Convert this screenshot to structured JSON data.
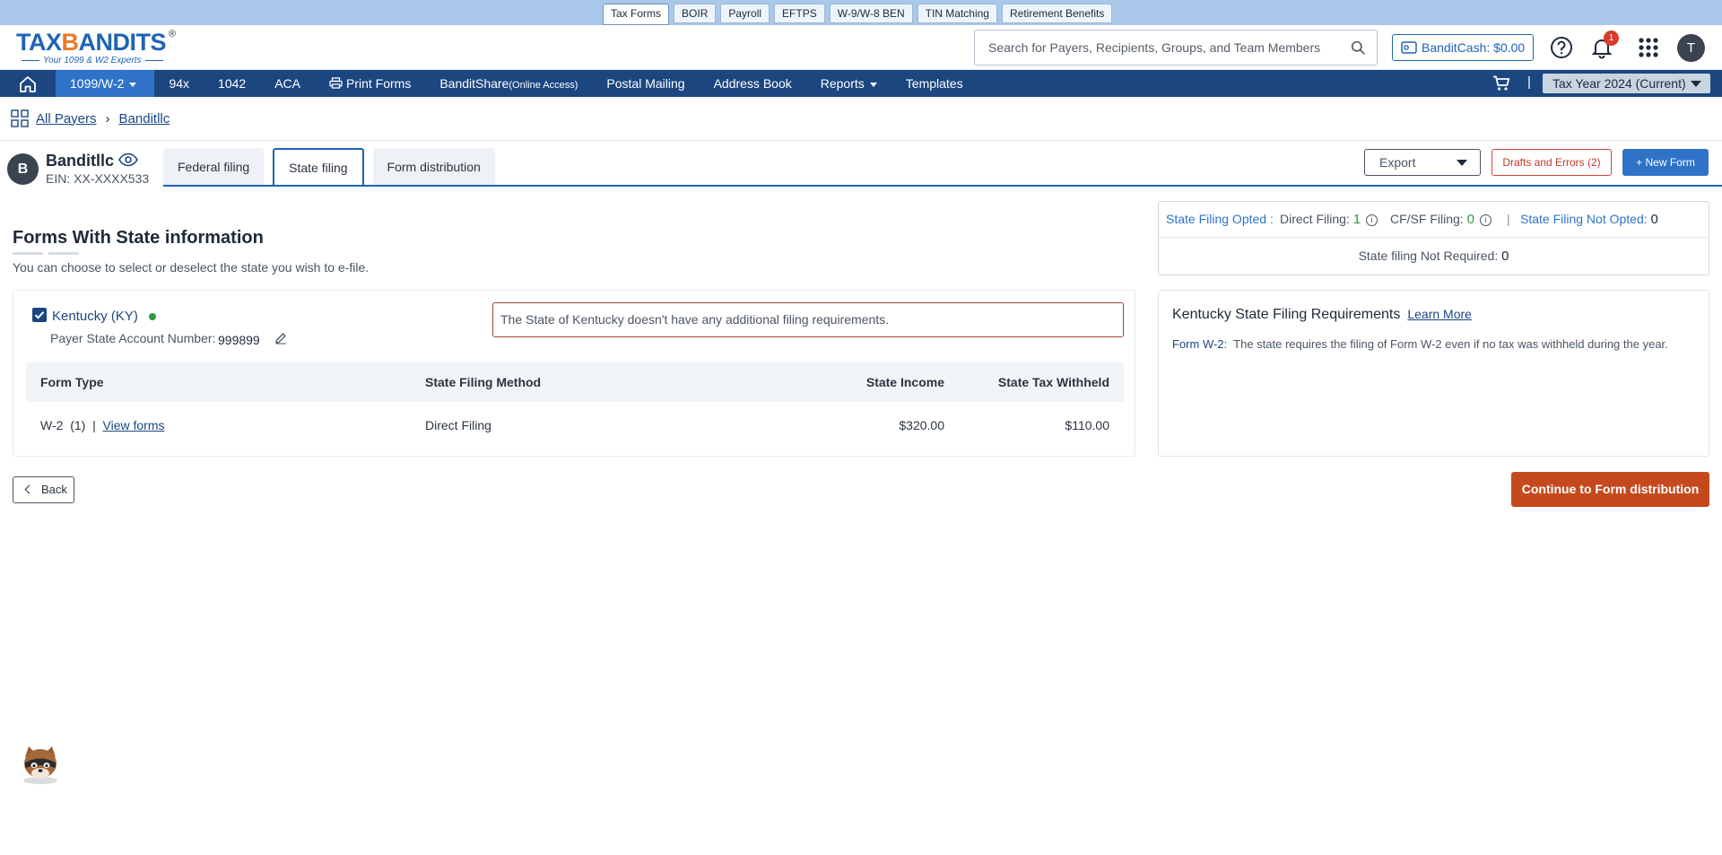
{
  "product_tabs": [
    "Tax Forms",
    "BOIR",
    "Payroll",
    "EFTPS",
    "W-9/W-8 BEN",
    "TIN Matching",
    "Retirement Benefits"
  ],
  "logo": {
    "brand": "TAXBANDITS",
    "sub": "Your 1099 & W2 Experts"
  },
  "search": {
    "placeholder": "Search for Payers, Recipients, Groups, and Team Members"
  },
  "bandit_cash": {
    "label": "BanditCash:",
    "amount": "$0.00"
  },
  "notifications": {
    "count": "1"
  },
  "user": {
    "initial": "T"
  },
  "nav": {
    "items": [
      "1099/W-2",
      "94x",
      "1042",
      "ACA",
      "Print Forms",
      "BanditShare",
      "Postal Mailing",
      "Address Book",
      "Reports",
      "Templates"
    ],
    "banditshare_suffix": "(Online Access)",
    "tax_year": "Tax Year 2024 (Current)"
  },
  "breadcrumb": {
    "root": "All Payers",
    "current": "Banditllc"
  },
  "payer": {
    "initial": "B",
    "name": "Banditllc",
    "ein": "EIN: XX-XXXX533"
  },
  "subtabs": [
    "Federal filing",
    "State filing",
    "Form distribution"
  ],
  "actions": {
    "export": "Export",
    "drafts": "Drafts and Errors (2)",
    "new_form": "New Form"
  },
  "section": {
    "title": "Forms With State information",
    "description": "You can choose to select or deselect the state you wish to e-file."
  },
  "state": {
    "name": "Kentucky (KY)",
    "account_label": "Payer State Account Number:",
    "account_number": "999899",
    "note": "The State of Kentucky doesn't have any additional filing requirements.",
    "columns": [
      "Form Type",
      "State Filing Method",
      "State Income",
      "State Tax Withheld"
    ],
    "rows": [
      {
        "form_type": "W-2  (1)  |",
        "link": "View forms",
        "method": "Direct Filing",
        "income": "$320.00",
        "withheld": "$110.00"
      }
    ]
  },
  "counts": {
    "opted_label": "State Filing Opted :",
    "direct_label": "Direct Filing:",
    "direct_value": "1",
    "cfsf_label": "CF/SF Filing:",
    "cfsf_value": "0",
    "separator": "|",
    "not_opted_label": "State Filing Not Opted:",
    "not_opted_value": "0",
    "not_required_label": "State filing Not Required:",
    "not_required_value": "0"
  },
  "requirements": {
    "title": "Kentucky State Filing Requirements",
    "learn_more": "Learn More",
    "form_label": "Form W-2:",
    "text": "The state requires the filing of Form W-2 even if no tax was withheld during the year."
  },
  "buttons": {
    "back": "Back",
    "continue": "Continue to Form distribution"
  },
  "colors": {
    "nav_bg": "#1c4680",
    "accent": "#1f63b6",
    "continue_bg": "#c5491d",
    "strip_bg": "#a9c8ea"
  }
}
